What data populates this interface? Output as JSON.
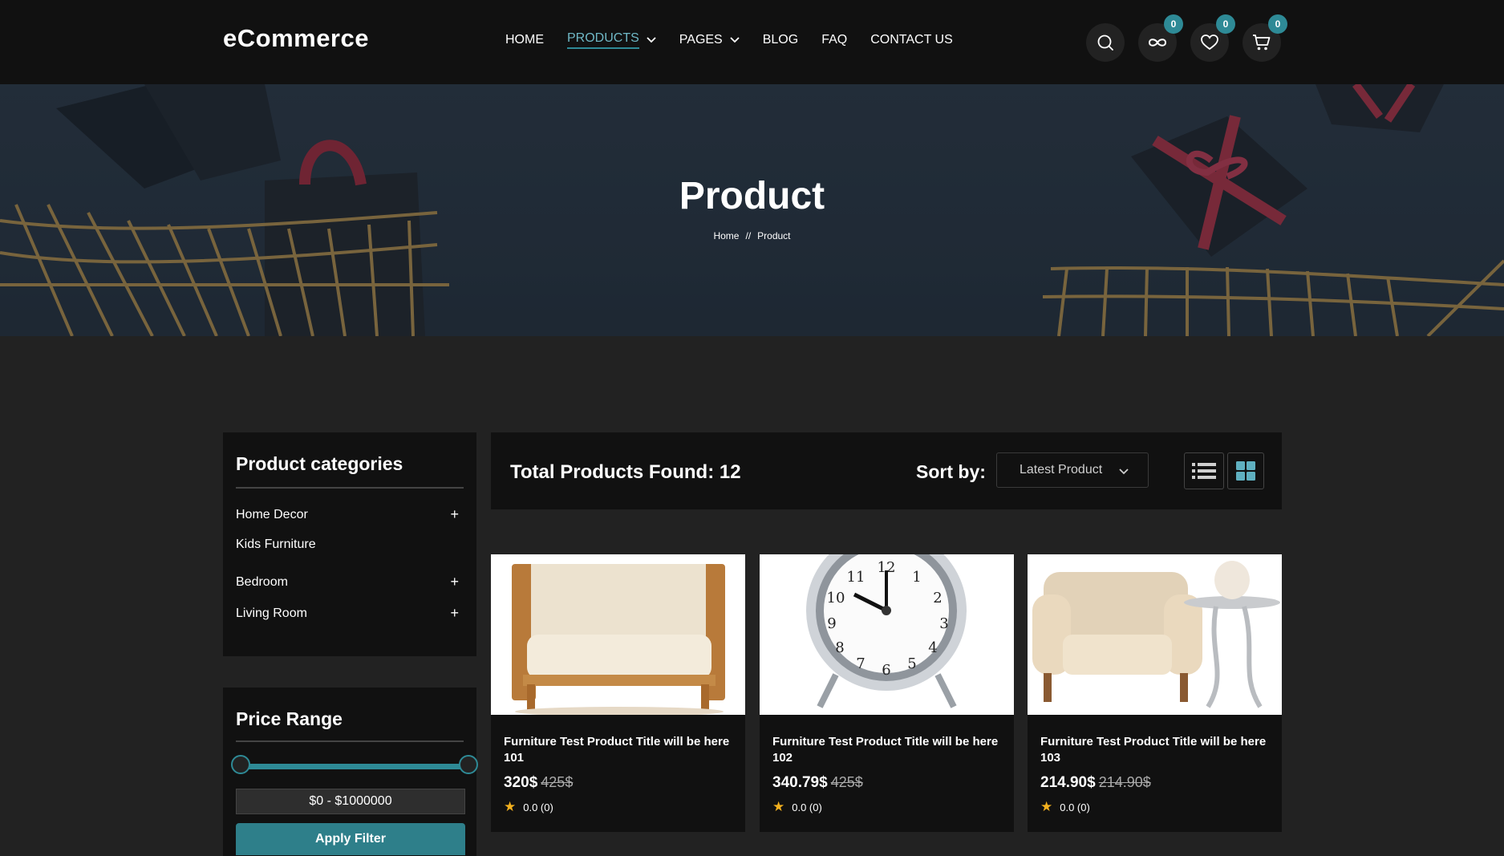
{
  "header": {
    "logo": "eCommerce",
    "nav": [
      {
        "label": "HOME"
      },
      {
        "label": "PRODUCTS"
      },
      {
        "label": "PAGES"
      },
      {
        "label": "BLOG"
      },
      {
        "label": "FAQ"
      },
      {
        "label": "CONTACT US"
      }
    ],
    "badges": {
      "compare": "0",
      "wishlist": "0",
      "cart": "0"
    },
    "accent_color": "#2e8a96"
  },
  "hero": {
    "title": "Product",
    "breadcrumb": {
      "home": "Home",
      "separator": "//",
      "current": "Product"
    }
  },
  "sidebar": {
    "categories_title": "Product categories",
    "categories": [
      {
        "label": "Home Decor",
        "expand": "+"
      },
      {
        "label": "Kids Furniture",
        "expand": ""
      },
      {
        "label": "Bedroom",
        "expand": "+"
      },
      {
        "label": "Living Room",
        "expand": "+"
      }
    ],
    "price_title": "Price Range",
    "price_range": "$0 - $1000000",
    "apply_label": "Apply Filter"
  },
  "toolbar": {
    "total": "Total Products Found: 12",
    "sort_label": "Sort by:",
    "sort_value": "Latest Product"
  },
  "products": [
    {
      "title": "Furniture Test Product Title will be here 101",
      "price": "320$",
      "old_price": "425$",
      "rating": "0.0 (0)"
    },
    {
      "title": "Furniture Test Product Title will be here 102",
      "price": "340.79$",
      "old_price": "425$",
      "rating": "0.0 (0)"
    },
    {
      "title": "Furniture Test Product Title will be here 103",
      "price": "214.90$",
      "old_price": "214.90$",
      "rating": "0.0 (0)"
    }
  ]
}
